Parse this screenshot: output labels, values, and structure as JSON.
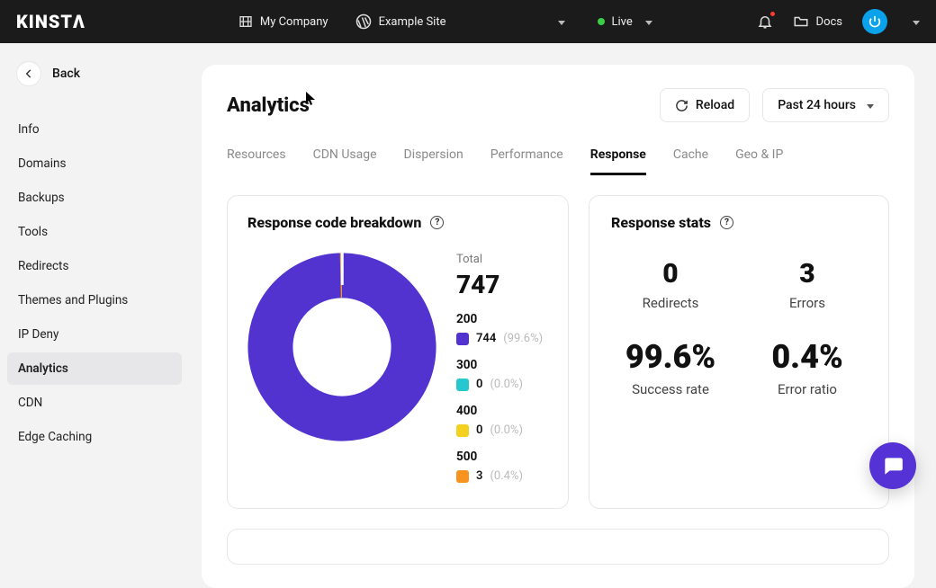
{
  "header": {
    "logo": "KINSTΛ",
    "company": "My Company",
    "site": "Example Site",
    "env": "Live",
    "docs": "Docs"
  },
  "sidebar": {
    "back": "Back",
    "items": [
      "Info",
      "Domains",
      "Backups",
      "Tools",
      "Redirects",
      "Themes and Plugins",
      "IP Deny",
      "Analytics",
      "CDN",
      "Edge Caching"
    ],
    "selected_index": 7
  },
  "page": {
    "title": "Analytics",
    "reload": "Reload",
    "period": "Past 24 hours",
    "tabs": [
      "Resources",
      "CDN Usage",
      "Dispersion",
      "Performance",
      "Response",
      "Cache",
      "Geo & IP"
    ],
    "active_tab_index": 4
  },
  "breakdown": {
    "title": "Response code breakdown",
    "total_label": "Total",
    "total": "747",
    "groups": [
      {
        "code": "200",
        "color": "#5333d0",
        "value": "744",
        "pct": "(99.6%)"
      },
      {
        "code": "300",
        "color": "#26c7cf",
        "value": "0",
        "pct": "(0.0%)"
      },
      {
        "code": "400",
        "color": "#f3d21f",
        "value": "0",
        "pct": "(0.0%)"
      },
      {
        "code": "500",
        "color": "#f7931e",
        "value": "3",
        "pct": "(0.4%)"
      }
    ]
  },
  "stats": {
    "title": "Response stats",
    "redirects": {
      "value": "0",
      "label": "Redirects"
    },
    "errors": {
      "value": "3",
      "label": "Errors"
    },
    "success_rate": {
      "value": "99.6%",
      "label": "Success rate"
    },
    "error_ratio": {
      "value": "0.4%",
      "label": "Error ratio"
    }
  },
  "chart_data": {
    "type": "pie",
    "title": "Response code breakdown",
    "categories": [
      "200",
      "300",
      "400",
      "500"
    ],
    "values": [
      744,
      0,
      0,
      3
    ],
    "percents": [
      99.6,
      0.0,
      0.0,
      0.4
    ],
    "total": 747,
    "colors": [
      "#5333d0",
      "#26c7cf",
      "#f3d21f",
      "#f7931e"
    ]
  }
}
